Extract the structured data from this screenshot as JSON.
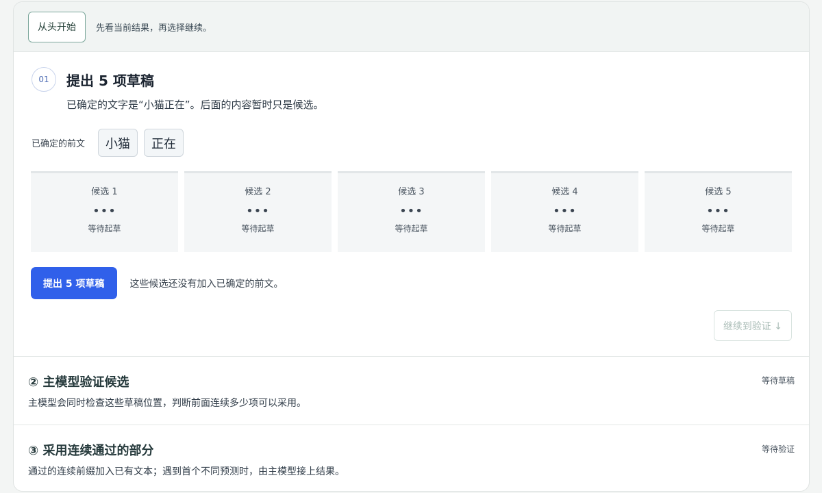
{
  "header": {
    "restart_label": "从头开始",
    "hint": "先看当前结果，再选择继续。"
  },
  "step1": {
    "number": "01",
    "title": "提出 5 项草稿",
    "description": "已确定的文字是“小猫正在”。后面的内容暂时只是候选。",
    "prefix_label": "已确定的前文",
    "tokens": [
      "小猫",
      "正在"
    ],
    "candidates": [
      {
        "title": "候选 1",
        "dots": "•••",
        "status": "等待起草"
      },
      {
        "title": "候选 2",
        "dots": "•••",
        "status": "等待起草"
      },
      {
        "title": "候选 3",
        "dots": "•••",
        "status": "等待起草"
      },
      {
        "title": "候选 4",
        "dots": "•••",
        "status": "等待起草"
      },
      {
        "title": "候选 5",
        "dots": "•••",
        "status": "等待起草"
      }
    ],
    "draft_button": "提出 5 项草稿",
    "action_hint": "这些候选还没有加入已确定的前文。",
    "continue_button": "继续到验证 ↓"
  },
  "step2": {
    "title": "② 主模型验证候选",
    "description": "主模型会同时检查这些草稿位置，判断前面连续多少项可以采用。",
    "status": "等待草稿"
  },
  "step3": {
    "title": "③ 采用连续通过的部分",
    "description": "通过的连续前缀加入已有文本；遇到首个不同预测时，由主模型接上结果。",
    "status": "等待验证"
  },
  "colors": {
    "accent": "#3060ea",
    "restart_border": "#7aa69a",
    "disabled_text": "#a9bcb6"
  }
}
